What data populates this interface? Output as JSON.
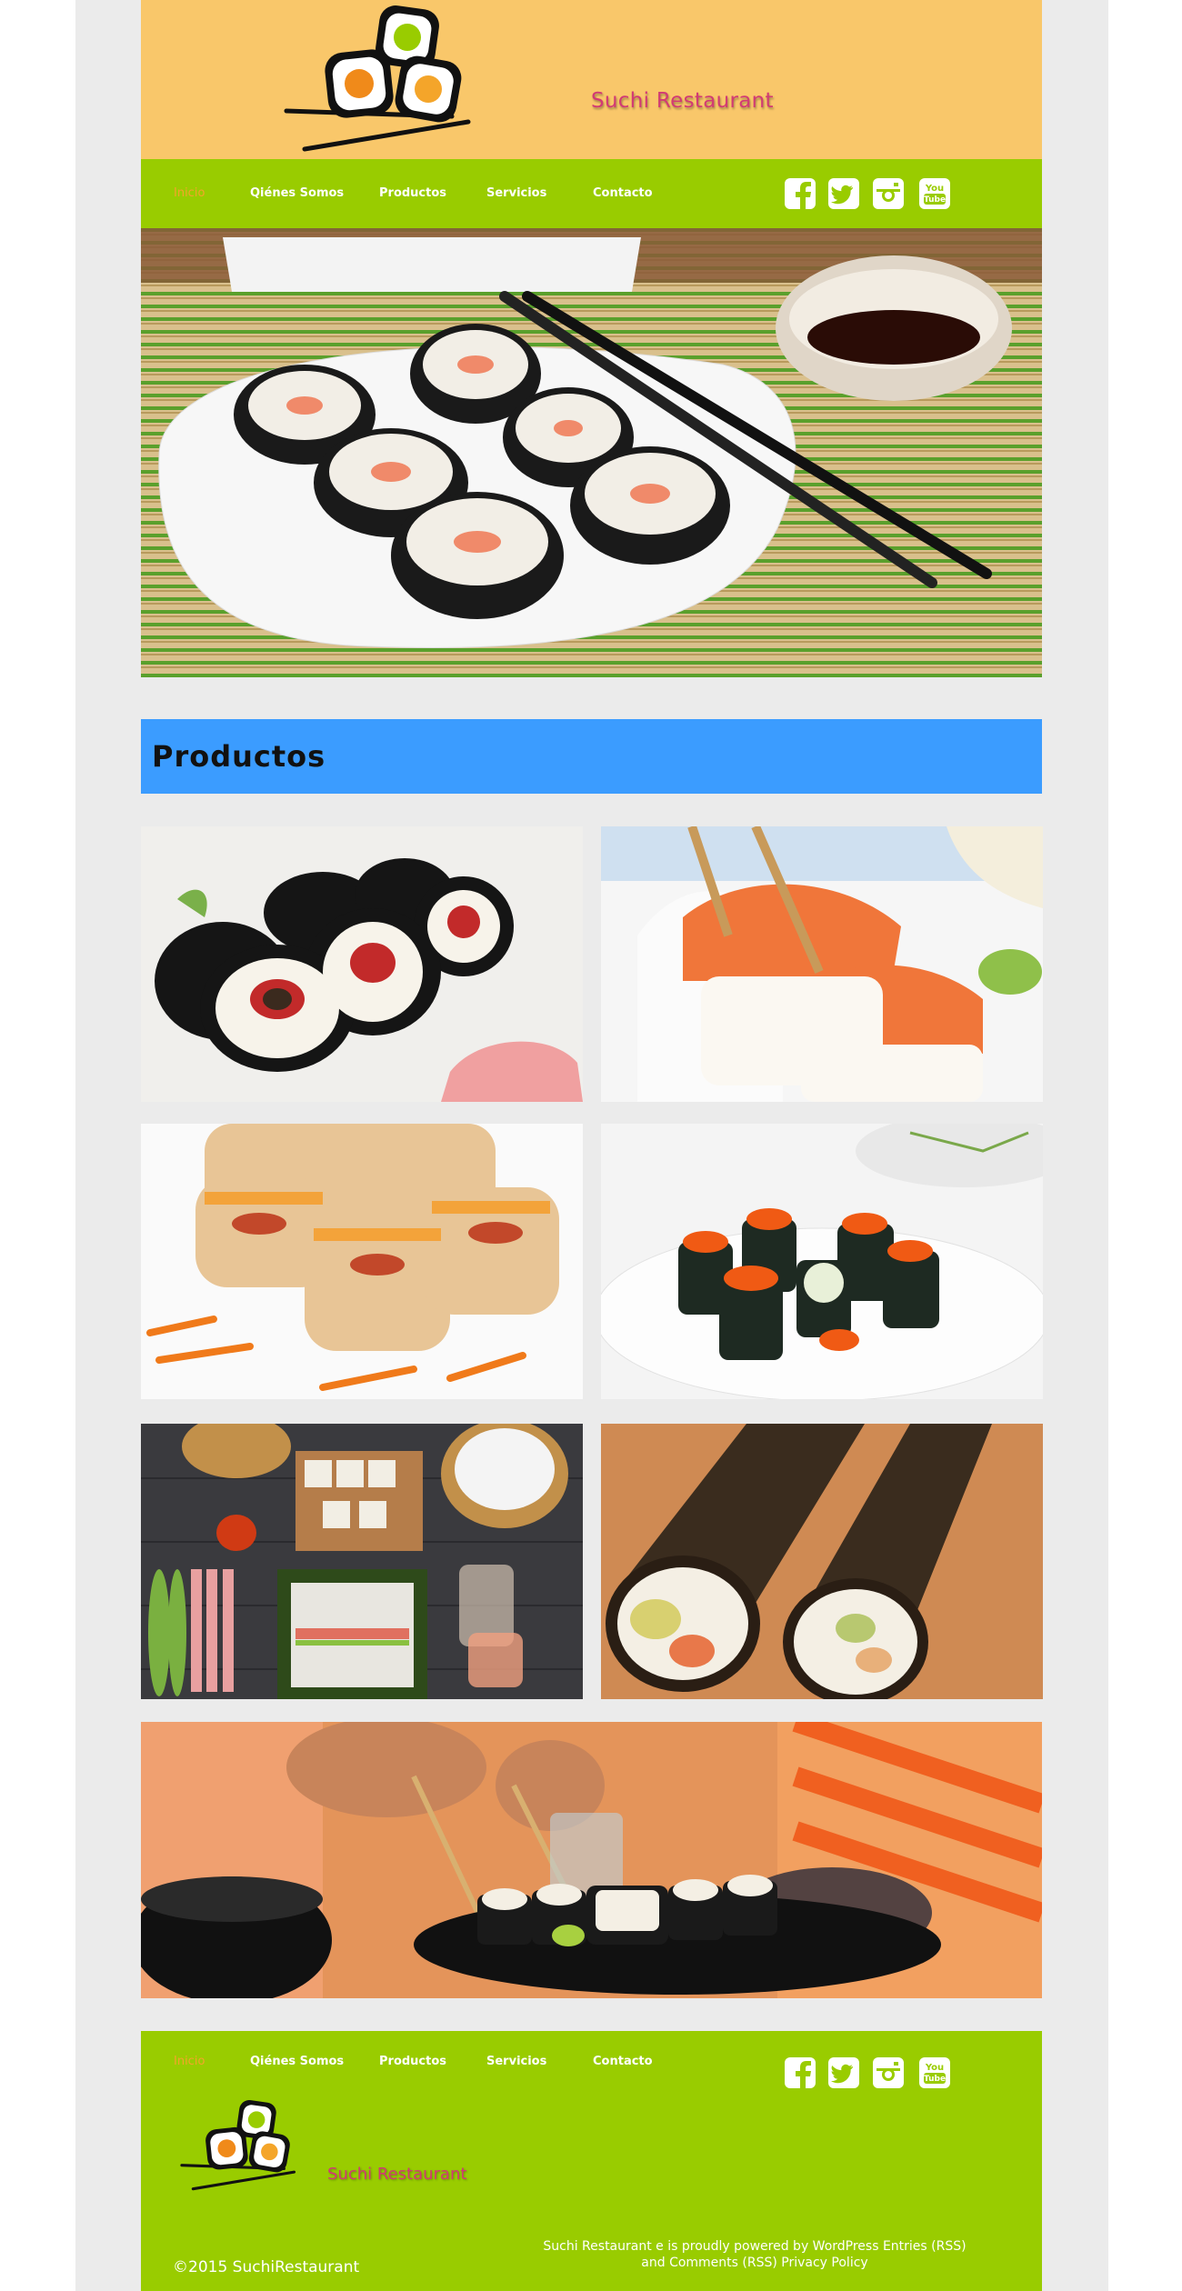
{
  "header": {
    "brand": "Suchi Restaurant",
    "bg_color": "#f9c76a"
  },
  "nav": {
    "items": [
      {
        "label": "Inicio",
        "active": true
      },
      {
        "label": "Qiénes Somos"
      },
      {
        "label": "Productos"
      },
      {
        "label": "Servicios"
      },
      {
        "label": "Contacto"
      }
    ],
    "social": [
      "facebook-icon",
      "twitter-icon",
      "instagram-icon",
      "youtube-icon"
    ],
    "bg_color": "#99cc00",
    "active_color": "#f4a52a"
  },
  "products": {
    "title": "Productos",
    "bar_color": "#3b9cff"
  },
  "footer": {
    "nav": [
      {
        "label": "Inicio",
        "active": true
      },
      {
        "label": "Qiénes Somos"
      },
      {
        "label": "Productos"
      },
      {
        "label": "Servicios"
      },
      {
        "label": "Contacto"
      }
    ],
    "brand": "Suchi Restaurant",
    "copyright": "©2015 SuchiRestaurant",
    "powered_line1": "Suchi Restaurant e is proudly powered by WordPress Entries (RSS)",
    "powered_line2": "and Comments (RSS) Privacy Policy"
  }
}
